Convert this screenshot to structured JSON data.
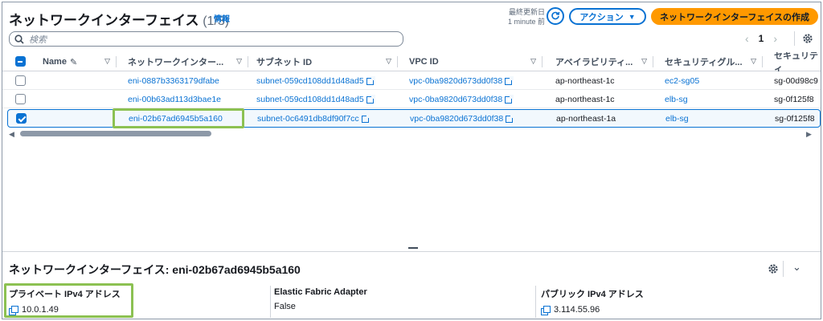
{
  "header": {
    "title": "ネットワークインターフェイス",
    "count": "(1/3)",
    "info_link": "情報",
    "last_updated_label": "最終更新日",
    "last_updated_value": "1 minute 前",
    "actions_label": "アクション",
    "create_label": "ネットワークインターフェイスの作成"
  },
  "search": {
    "placeholder": "検索"
  },
  "pagination": {
    "page": "1"
  },
  "table": {
    "columns": [
      "Name",
      "ネットワークインター...",
      "サブネット ID",
      "VPC ID",
      "アベイラビリティ...",
      "セキュリティグル...",
      "セキュリティ"
    ],
    "rows": [
      {
        "selected": false,
        "name": "",
        "eni": "eni-0887b3363179dfabe",
        "subnet": "subnet-059cd108dd1d48ad5",
        "vpc": "vpc-0ba9820d673dd0f38",
        "az": "ap-northeast-1c",
        "sg_name": "ec2-sg05",
        "sg_id": "sg-00d98c9"
      },
      {
        "selected": false,
        "name": "",
        "eni": "eni-00b63ad113d3bae1e",
        "subnet": "subnet-059cd108dd1d48ad5",
        "vpc": "vpc-0ba9820d673dd0f38",
        "az": "ap-northeast-1c",
        "sg_name": "elb-sg",
        "sg_id": "sg-0f125f8"
      },
      {
        "selected": true,
        "name": "",
        "eni": "eni-02b67ad6945b5a160",
        "subnet": "subnet-0c6491db8df90f7cc",
        "vpc": "vpc-0ba9820d673dd0f38",
        "az": "ap-northeast-1a",
        "sg_name": "elb-sg",
        "sg_id": "sg-0f125f8"
      }
    ]
  },
  "detail": {
    "title": "ネットワークインターフェイス: eni-02b67ad6945b5a160",
    "private_ip_label": "プライベート IPv4 アドレス",
    "private_ip": "10.0.1.49",
    "efa_label": "Elastic Fabric Adapter",
    "efa_value": "False",
    "public_ip_label": "パブリック IPv4 アドレス",
    "public_ip": "3.114.55.96"
  },
  "colors": {
    "accent": "#0972d3",
    "primary_button": "#ff9900",
    "highlight": "#8cc152"
  },
  "icons": [
    "search-icon",
    "refresh-icon",
    "caret-down-icon",
    "settings-icon",
    "external-link-icon",
    "copy-icon",
    "chevron-down-icon",
    "edit-icon"
  ]
}
